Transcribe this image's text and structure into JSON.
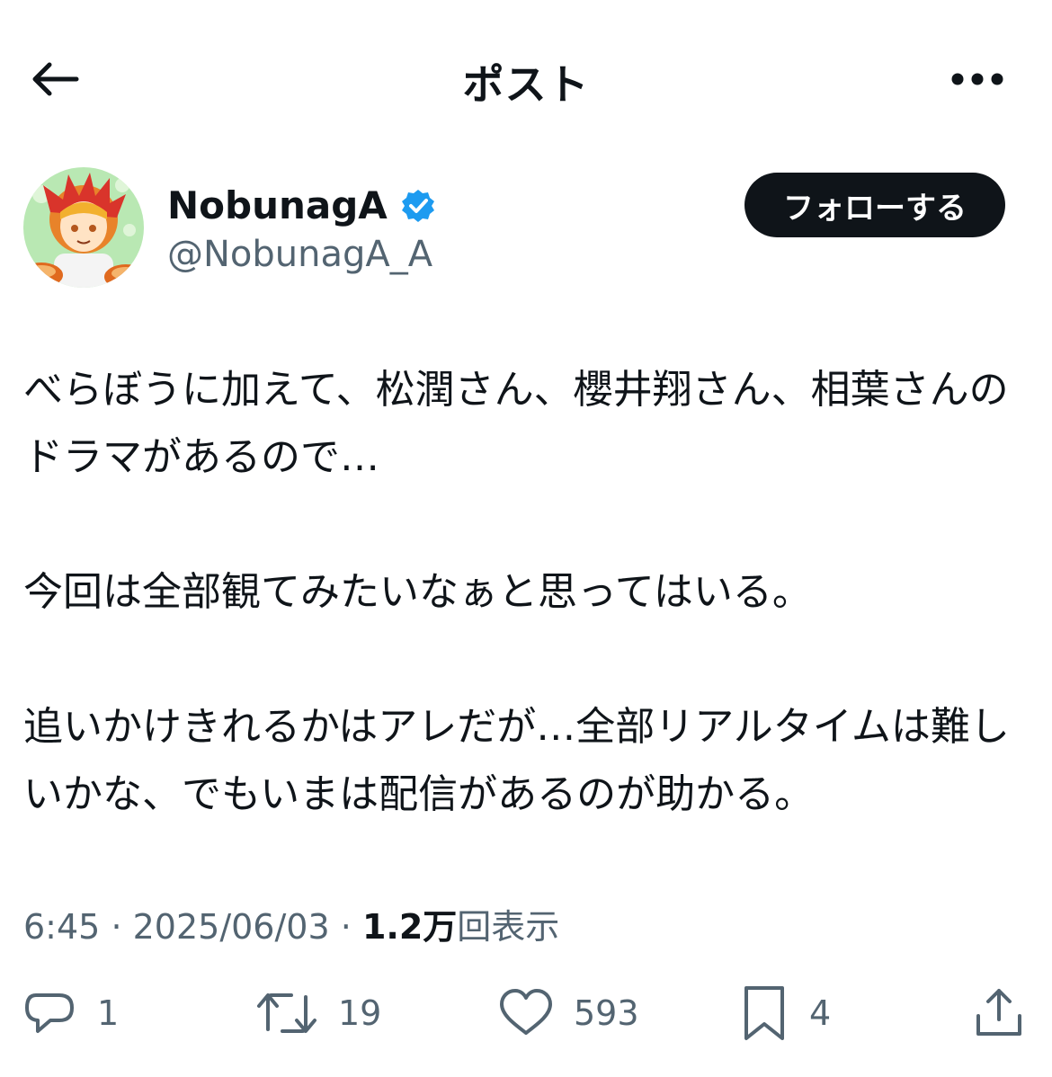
{
  "header": {
    "title": "ポスト",
    "back_icon": "arrow-left-icon",
    "more_icon": "more-horizontal-icon"
  },
  "author": {
    "display_name": "NobunagA",
    "handle": "@NobunagA_A",
    "verified": true,
    "verified_color": "#1d9bf0",
    "follow_label": "フォローする"
  },
  "post": {
    "paragraphs": [
      "べらぼうに加えて、松潤さん、櫻井翔さん、相葉さんのドラマがあるので…",
      "今回は全部観てみたいなぁと思ってはいる。",
      "追いかけきれるかはアレだが…全部リアルタイムは難しいかな、でもいまは配信があるのが助かる。"
    ]
  },
  "meta": {
    "time": "6:45",
    "separator": "·",
    "date": "2025/06/03",
    "views_count": "1.2万",
    "views_label": "回表示"
  },
  "actions": {
    "reply_count": "1",
    "repost_count": "19",
    "like_count": "593",
    "bookmark_count": "4"
  }
}
